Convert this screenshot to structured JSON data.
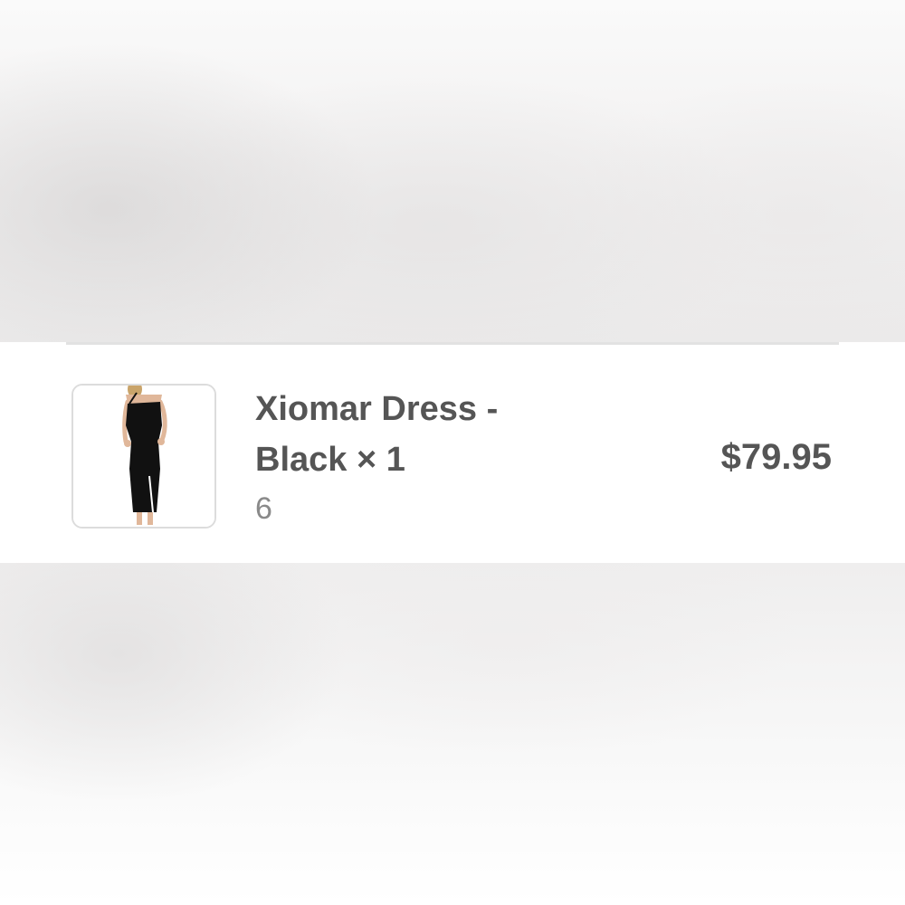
{
  "order_item": {
    "title": "Xiomar Dress - Black × 1",
    "variant": "6",
    "price": "$79.95",
    "thumbnail_alt": "Xiomar Dress - Black"
  },
  "colors": {
    "text_primary": "#555555",
    "text_secondary": "#8a8a8a",
    "divider": "#e2e2e2",
    "thumbnail_border": "#dcdcdc",
    "dress": "#111111"
  }
}
